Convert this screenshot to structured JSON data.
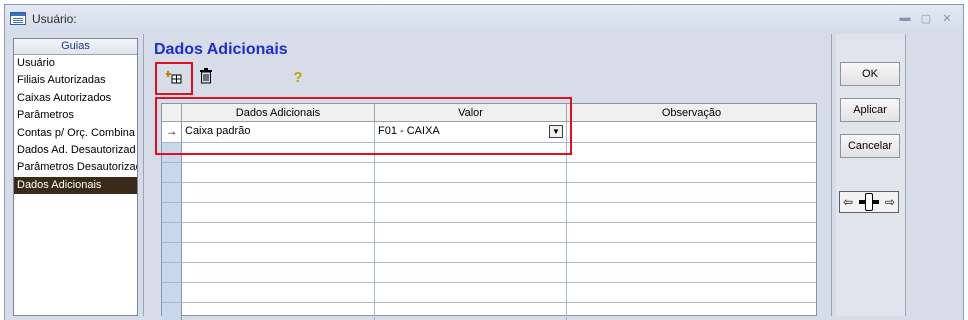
{
  "window": {
    "title": "Usuário: "
  },
  "sidebar": {
    "header": "Guias",
    "items": [
      {
        "label": "Usuário"
      },
      {
        "label": "Filiais Autorizadas"
      },
      {
        "label": "Caixas Autorizados"
      },
      {
        "label": "Parâmetros"
      },
      {
        "label": "Contas p/ Orç. Combina"
      },
      {
        "label": "Dados Ad. Desautorizad"
      },
      {
        "label": "Parâmetros Desautorizac"
      },
      {
        "label": "Dados Adicionais"
      }
    ],
    "selected_index": 7
  },
  "main": {
    "heading": "Dados Adicionais",
    "toolbar": {
      "add_icon": "add-record-icon",
      "delete_icon": "trash-icon",
      "help_icon": "help-icon"
    },
    "grid": {
      "columns": [
        "Dados Adicionais",
        "Valor",
        "Observação"
      ],
      "rows": [
        {
          "indicator": "→",
          "dados": "Caixa padrão",
          "valor": "F01 - CAIXA",
          "observacao": ""
        }
      ]
    }
  },
  "actions": {
    "ok": "OK",
    "apply": "Aplicar",
    "cancel": "Cancelar",
    "nav_left": "⇦",
    "nav_right": "⇨"
  },
  "colors": {
    "heading": "#1c2ecc",
    "highlight": "#e01020",
    "selected_bg": "#3a2a1a"
  }
}
